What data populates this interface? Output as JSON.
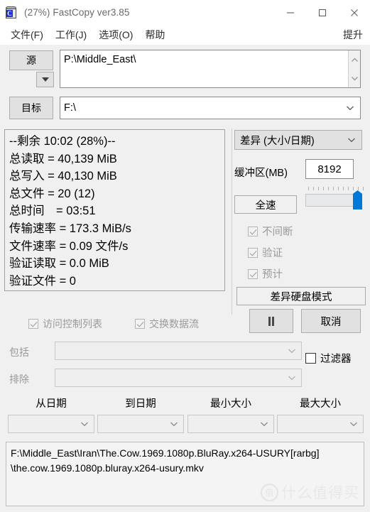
{
  "window": {
    "title": "(27%) FastCopy ver3.85",
    "icon": "app-drum-icon",
    "icon_letter": "C",
    "minimize": "minimize-icon",
    "maximize": "maximize-icon",
    "close": "close-icon"
  },
  "menu": {
    "items": [
      {
        "label": "文件(F)"
      },
      {
        "label": "工作(J)"
      },
      {
        "label": "选项(O)"
      },
      {
        "label": "帮助"
      }
    ],
    "right_label": "提升"
  },
  "paths": {
    "source_button": "源",
    "source_value": "P:\\Middle_East\\",
    "source_dropdown_icon": "triangle-down-icon",
    "scroll_up_icon": "chevron-up-icon",
    "scroll_down_icon": "chevron-down-icon",
    "dest_button": "目标",
    "dest_value": "F:\\",
    "dest_chevron_icon": "chevron-down-icon"
  },
  "stats": {
    "lines": [
      "--剩余 10:02 (28%)--",
      "总读取 = 40,139 MiB",
      "总写入 = 40,130 MiB",
      "总文件 = 20 (12)",
      "总时间　= 03:51",
      "传输速率 = 173.3 MiB/s",
      "文件速率 = 0.09 文件/s",
      "验证读取 = 0.0 MiB",
      "验证文件 = 0"
    ],
    "remaining_time": "10:02",
    "progress_percent": "28%",
    "total_read": "40,139 MiB",
    "total_write": "40,130 MiB",
    "total_files": "20 (12)",
    "total_time": "03:51",
    "transfer_rate": "173.3 MiB/s",
    "file_rate": "0.09 文件/s",
    "verify_read": "0.0 MiB",
    "verify_files": "0"
  },
  "lower_left_options": [
    {
      "label": "访问控制列表",
      "checked": true,
      "enabled": false
    },
    {
      "label": "交换数据流",
      "checked": true,
      "enabled": false
    }
  ],
  "options": {
    "mode_value": "差异 (大小/日期)",
    "mode_chevron_icon": "chevron-down-icon",
    "buffer_label": "缓冲区(MB)",
    "buffer_value": "8192",
    "fullspeed_label": "全速",
    "slider_position_percent": 100,
    "slider_accent_color": "#0078d7",
    "checkboxes": [
      {
        "label": "不间断",
        "checked": true,
        "enabled": false
      },
      {
        "label": "验证",
        "checked": true,
        "enabled": false
      },
      {
        "label": "预计",
        "checked": true,
        "enabled": false
      }
    ],
    "diff_disk_mode_label": "差异硬盘模式",
    "pause_icon": "pause-icon",
    "cancel_label": "取消"
  },
  "filters": {
    "include_label": "包括",
    "include_value": "",
    "exclude_label": "排除",
    "exclude_value": "",
    "filter_checkbox_label": "过滤器",
    "filter_checked": false,
    "chevron_icon": "chevron-down-icon"
  },
  "date_size": {
    "columns": [
      {
        "header": "从日期",
        "value": ""
      },
      {
        "header": "到日期",
        "value": ""
      },
      {
        "header": "最小大小",
        "value": ""
      },
      {
        "header": "最大大小",
        "value": ""
      }
    ],
    "chevron_icon": "chevron-down-icon"
  },
  "log": {
    "lines": [
      "F:\\Middle_East\\Iran\\The.Cow.1969.1080p.BluRay.x264-USURY[rarbg]",
      "\\the.cow.1969.1080p.bluray.x264-usury.mkv"
    ],
    "watermark_mark": "值",
    "watermark_text": "什么值得买"
  }
}
